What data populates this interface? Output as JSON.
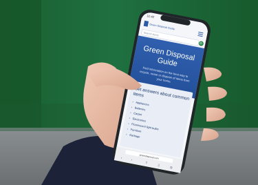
{
  "status_bar": {
    "time": "11:42"
  },
  "site": {
    "logo_text": "Green Disposal Guide",
    "search_placeholder": "Search items",
    "hero_title_line1": "Green Disposal",
    "hero_title_line2": "Guide",
    "hero_subtitle_line1": "Find information on the best way to",
    "hero_subtitle_line2": "recycle, reuse or dispose of items from",
    "hero_subtitle_line3": "your home.",
    "common_items_title_line1": "Get answers about common",
    "common_items_title_line2": "items",
    "items": [
      "Appliances",
      "Batteries",
      "Carpet",
      "Electronics",
      "Fluorescent light bulbs",
      "Furniture",
      "Garbage"
    ]
  },
  "browser": {
    "url": "greendisposal.com"
  },
  "colors": {
    "background_green": "#1f6b3a",
    "site_blue": "#2c5aa6",
    "card_bg": "#e9edf5"
  }
}
